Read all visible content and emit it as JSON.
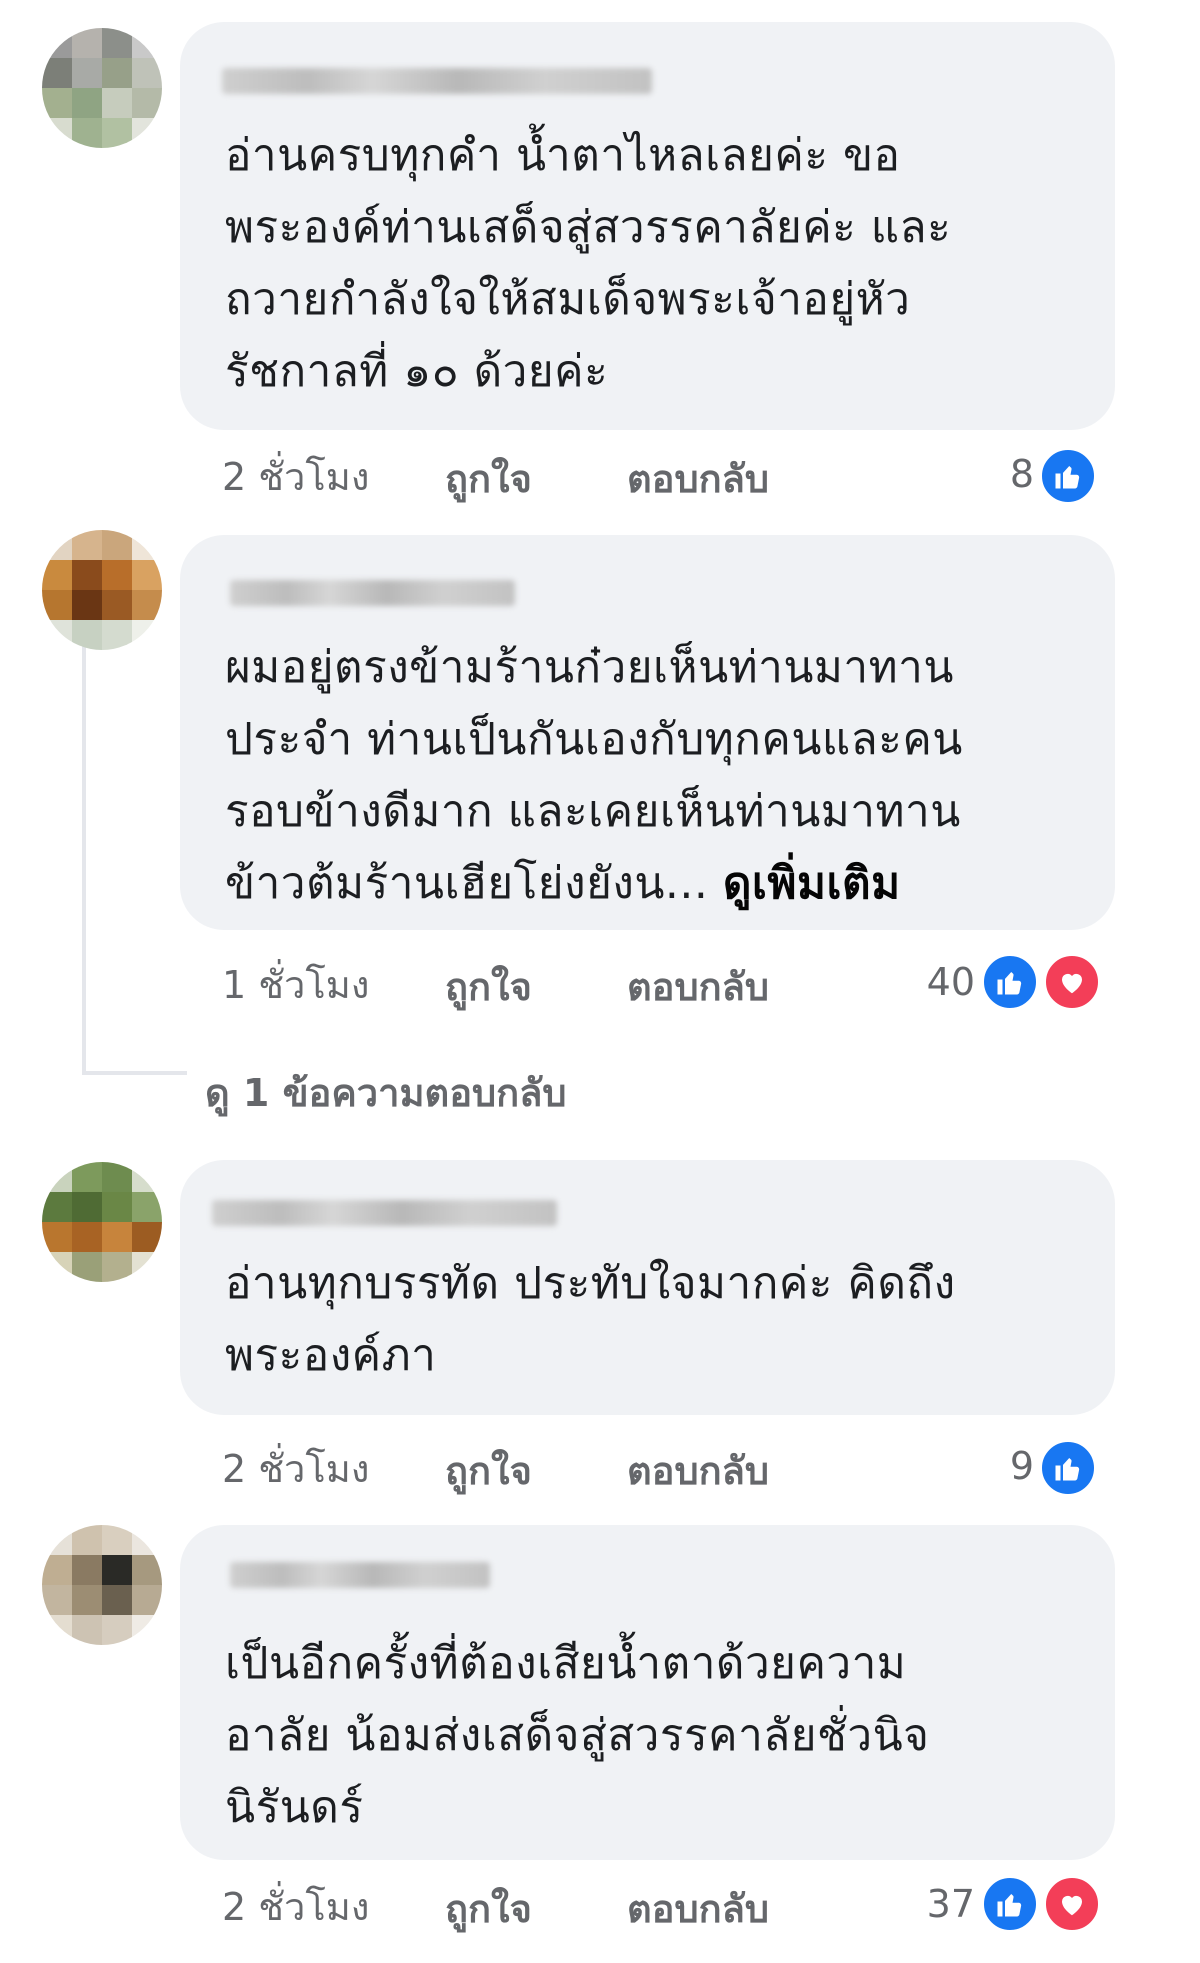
{
  "comments": [
    {
      "text": "อ่านครบทุกคำ น้ำตาไหลเลยค่ะ ขอ\nพระองค์ท่านเสด็จสู่สวรรคาลัยค่ะ และ\nถวายกำลังใจให้สมเด็จพระเจ้าอยู่หัว\nรัชกาลที่ ๑๐ ด้วยค่ะ",
      "time": "2 ชั่วโมง",
      "like_label": "ถูกใจ",
      "reply_label": "ตอบกลับ",
      "reaction_count": "8",
      "reactions": [
        "like-icon"
      ]
    },
    {
      "text": "ผมอยู่ตรงข้ามร้านก๋วยเห็นท่านมาทาน\nประจำ ท่านเป็นกันเองกับทุกคนและคน\nรอบข้างดีมาก และเคยเห็นท่านมาทาน\nข้าวต้มร้านเฮียโย่งยังน... ",
      "see_more": "ดูเพิ่มเติม",
      "time": "1 ชั่วโมง",
      "like_label": "ถูกใจ",
      "reply_label": "ตอบกลับ",
      "reaction_count": "40",
      "reactions": [
        "like-icon",
        "love-icon"
      ],
      "view_replies": "ดู 1 ข้อความตอบกลับ"
    },
    {
      "text": "อ่านทุกบรรทัด ประทับใจมากค่ะ คิดถึง\nพระองค์ภา",
      "time": "2 ชั่วโมง",
      "like_label": "ถูกใจ",
      "reply_label": "ตอบกลับ",
      "reaction_count": "9",
      "reactions": [
        "like-icon"
      ]
    },
    {
      "text": "เป็นอีกครั้งที่ต้องเสียน้ำตาด้วยความ\nอาลัย น้อมส่งเสด็จสู่สวรรคาลัยชั่วนิจ\nนิรันดร์",
      "time": "2 ชั่วโมง",
      "like_label": "ถูกใจ",
      "reply_label": "ตอบกลับ",
      "reaction_count": "37",
      "reactions": [
        "like-icon",
        "love-icon"
      ]
    }
  ],
  "colors": {
    "bubble": "#f0f2f5",
    "meta_text": "#65676b",
    "like": "#1877f2",
    "love": "#f33e58"
  }
}
